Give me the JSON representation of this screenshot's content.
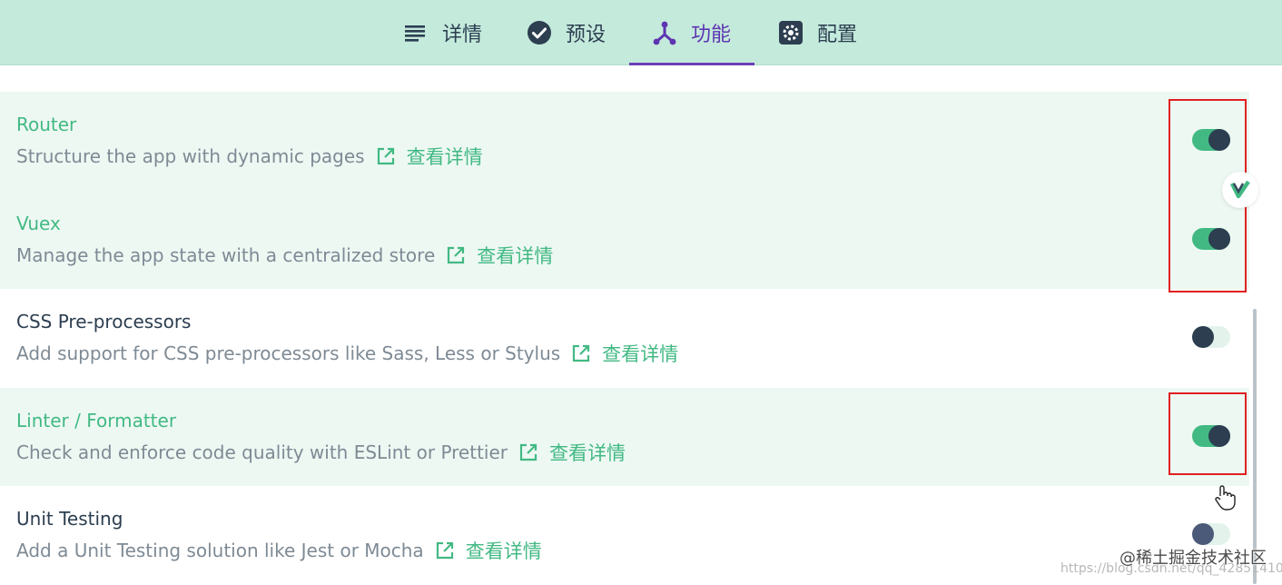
{
  "tabs": [
    {
      "id": "details",
      "label": "详情",
      "icon": "list-icon"
    },
    {
      "id": "presets",
      "label": "预设",
      "icon": "check-circle-icon"
    },
    {
      "id": "features",
      "label": "功能",
      "icon": "fork-icon",
      "active": true
    },
    {
      "id": "config",
      "label": "配置",
      "icon": "gear-icon"
    }
  ],
  "more_label": "查看详情",
  "features": [
    {
      "name": "Router",
      "description": "Structure the app with dynamic pages",
      "enabled": true
    },
    {
      "name": "Vuex",
      "description": "Manage the app state with a centralized store",
      "enabled": true
    },
    {
      "name": "CSS Pre-processors",
      "description": "Add support for CSS pre-processors like Sass, Less or Stylus",
      "enabled": false
    },
    {
      "name": "Linter / Formatter",
      "description": "Check and enforce code quality with ESLint or Prettier",
      "enabled": true
    },
    {
      "name": "Unit Testing",
      "description": "Add a Unit Testing solution like Jest or Mocha",
      "enabled": false
    }
  ],
  "colors": {
    "tabbar_bg": "#c4eadc",
    "accent_green": "#42b983",
    "active_tab": "#6a3fb5",
    "highlight_red": "#e02020"
  },
  "watermark": {
    "brand": "@稀土掘金技术社区",
    "url": "https://blog.csdn.net/qq_42851410"
  }
}
